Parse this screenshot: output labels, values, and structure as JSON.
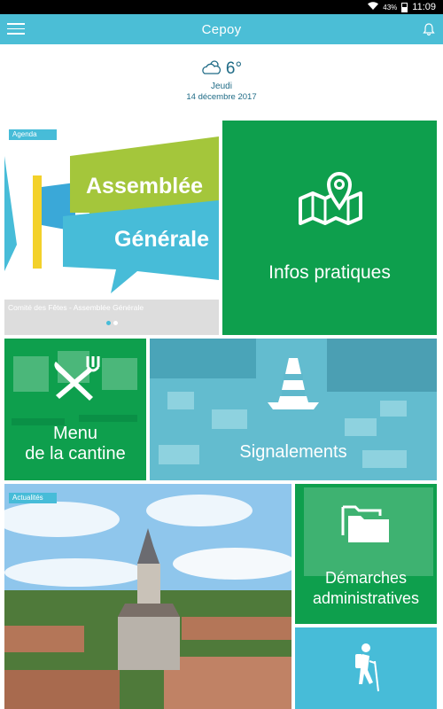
{
  "status_bar": {
    "battery": "43%",
    "time": "11:09"
  },
  "header": {
    "title": "Cepoy"
  },
  "weather": {
    "temperature": "6°",
    "day": "Jeudi",
    "date": "14 décembre 2017",
    "icon": "cloud-sun-icon"
  },
  "agenda": {
    "tag": "Agenda",
    "caption": "Comité des Fêtes - Assemblée Générale",
    "banner_line1": "Assemblée",
    "banner_line2": "Générale",
    "slides": 2,
    "active_slide": 1
  },
  "tiles": {
    "infos": {
      "label": "Infos pratiques",
      "icon": "map-pin-icon"
    },
    "menu": {
      "line1": "Menu",
      "line2": "de la cantine",
      "icon": "fork-knife-icon"
    },
    "signalements": {
      "label": "Signalements",
      "icon": "traffic-cone-icon"
    },
    "actualites": {
      "tag": "Actualités"
    },
    "demarches": {
      "line1": "Démarches",
      "line2": "administratives",
      "icon": "folder-icon"
    },
    "randonnee": {
      "icon": "hiker-icon"
    }
  },
  "colors": {
    "green": "#0e9f4d",
    "teal": "#47bcd8",
    "header": "#4bbed6"
  }
}
